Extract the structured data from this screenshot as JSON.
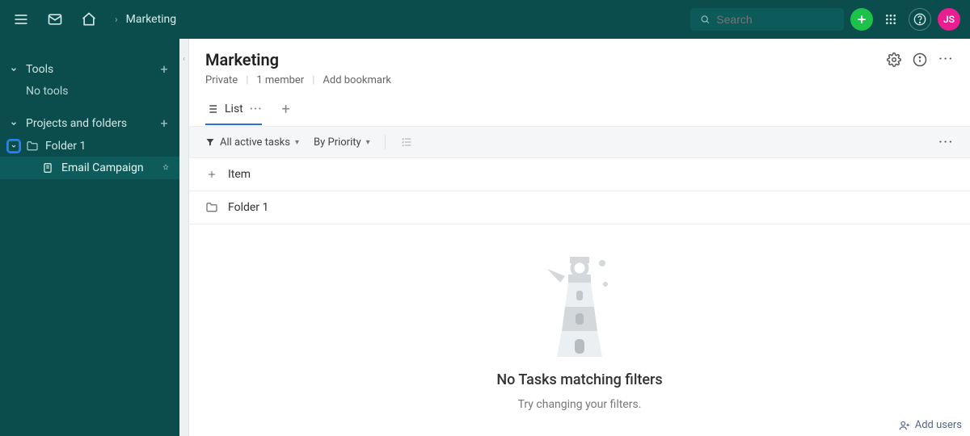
{
  "header": {
    "breadcrumb": "Marketing",
    "search_placeholder": "Search",
    "avatar_initials": "JS"
  },
  "sidebar": {
    "tools_label": "Tools",
    "no_tools": "No tools",
    "projects_label": "Projects and folders",
    "folder1": "Folder 1",
    "email_campaign": "Email Campaign"
  },
  "page": {
    "title": "Marketing",
    "privacy": "Private",
    "members": "1 member",
    "bookmark": "Add bookmark"
  },
  "views": {
    "list_label": "List"
  },
  "filters": {
    "tasks": "All active tasks",
    "sort": "By Priority"
  },
  "rows": {
    "add_item": "Item",
    "folder1": "Folder 1"
  },
  "empty": {
    "title": "No Tasks matching filters",
    "subtitle": "Try changing your filters."
  },
  "footer": {
    "add_users": "Add users"
  }
}
